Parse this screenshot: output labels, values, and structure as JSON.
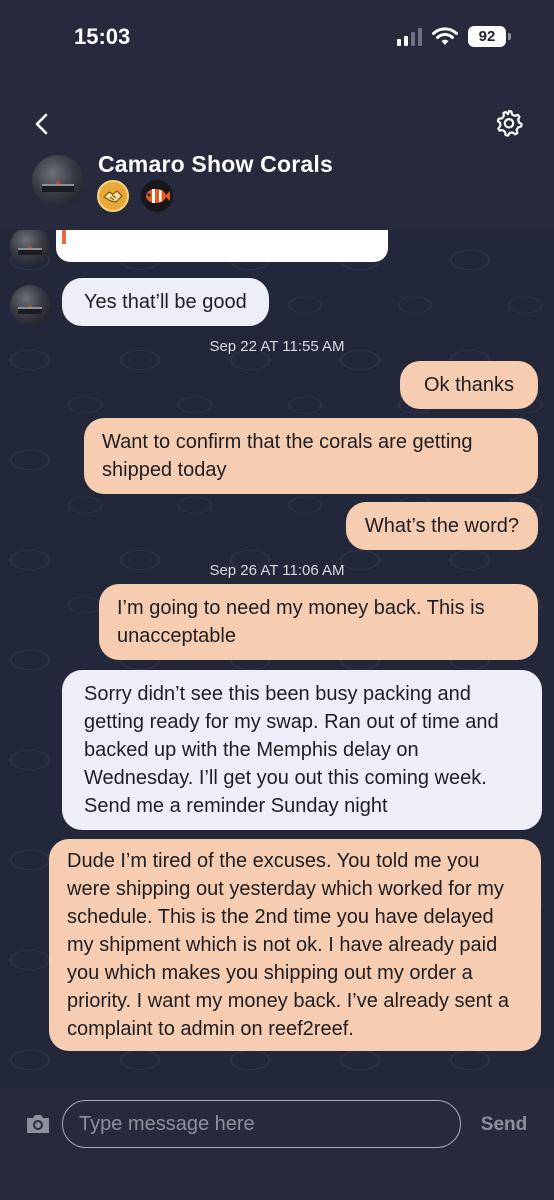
{
  "status_bar": {
    "time": "15:03",
    "battery": "92"
  },
  "header": {
    "contact_name": "Camaro Show Corals"
  },
  "messages": [
    {
      "dir": "in",
      "text": "Yes that’ll be good"
    },
    {
      "timestamp": "Sep 22 AT 11:55 AM"
    },
    {
      "dir": "out",
      "text": "Ok thanks"
    },
    {
      "dir": "out",
      "text": "Want to confirm that the corals are getting shipped today"
    },
    {
      "dir": "out",
      "text": "What’s the word?"
    },
    {
      "timestamp": "Sep 26 AT 11:06 AM"
    },
    {
      "dir": "out",
      "text": "I’m going to need my money back. This is unacceptable"
    },
    {
      "dir": "in",
      "text": "Sorry didn’t see this been busy packing and getting ready for my swap. Ran out of time and backed up with the Memphis delay on Wednesday. I’ll get you out this coming week. Send me a reminder Sunday night"
    },
    {
      "dir": "out",
      "text": "Dude I’m tired of the excuses. You told me you were shipping out yesterday which worked for my schedule. This is the 2nd time you have delayed my shipment which is not ok. I have already paid you which makes you shipping out my order a priority. I want my money back. I’ve already sent a complaint to admin on reef2reef."
    }
  ],
  "composer": {
    "placeholder": "Type message here",
    "send_label": "Send"
  },
  "colors": {
    "bubble_out": "#f7cdb1",
    "bubble_in": "#eeeef8",
    "background": "#23273a"
  },
  "icons": [
    "back-chevron-icon",
    "settings-gear-icon",
    "handshake-badge-icon",
    "clownfish-badge-icon",
    "camera-icon"
  ]
}
